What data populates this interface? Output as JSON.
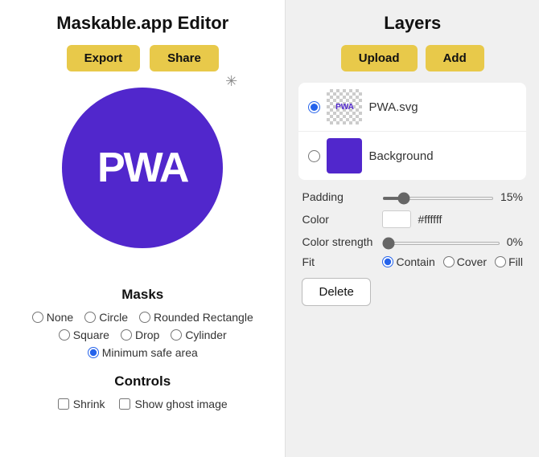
{
  "app": {
    "title": "Maskable.app Editor"
  },
  "toolbar": {
    "export_label": "Export",
    "share_label": "Share"
  },
  "icon": {
    "text": "PWA",
    "bg_color": "#5127cc"
  },
  "masks": {
    "title": "Masks",
    "options": [
      {
        "label": "None",
        "value": "none",
        "checked": false
      },
      {
        "label": "Circle",
        "value": "circle",
        "checked": false
      },
      {
        "label": "Rounded Rectangle",
        "value": "rounded-rectangle",
        "checked": false
      },
      {
        "label": "Square",
        "value": "square",
        "checked": false
      },
      {
        "label": "Drop",
        "value": "drop",
        "checked": false
      },
      {
        "label": "Cylinder",
        "value": "cylinder",
        "checked": false
      },
      {
        "label": "Minimum safe area",
        "value": "minimum-safe-area",
        "checked": true
      }
    ]
  },
  "controls": {
    "title": "Controls",
    "shrink_label": "Shrink",
    "ghost_label": "Show ghost image"
  },
  "layers": {
    "title": "Layers",
    "upload_label": "Upload",
    "add_label": "Add",
    "items": [
      {
        "name": "PWA.svg",
        "type": "svg",
        "selected": true
      },
      {
        "name": "Background",
        "type": "color",
        "selected": false
      }
    ]
  },
  "properties": {
    "padding_label": "Padding",
    "padding_value": "15%",
    "padding_percent": 15,
    "color_label": "Color",
    "color_hex": "#ffffff",
    "color_strength_label": "Color strength",
    "color_strength_value": "0%",
    "color_strength_percent": 0,
    "fit_label": "Fit",
    "fit_options": [
      {
        "label": "Contain",
        "value": "contain",
        "checked": true
      },
      {
        "label": "Cover",
        "value": "cover",
        "checked": false
      },
      {
        "label": "Fill",
        "value": "fill",
        "checked": false
      }
    ],
    "delete_label": "Delete"
  }
}
